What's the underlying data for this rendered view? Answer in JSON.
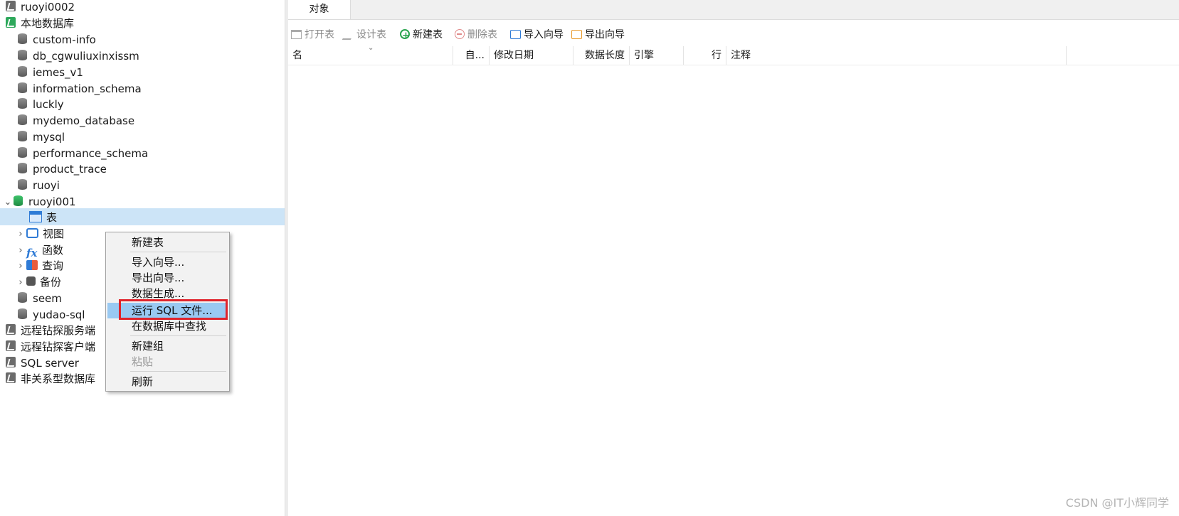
{
  "tree": {
    "connections_top": [
      {
        "label": "ruoyi0002"
      },
      {
        "label": "本地数据库"
      }
    ],
    "databases": [
      {
        "label": "custom-info"
      },
      {
        "label": "db_cgwuliuxinxissm"
      },
      {
        "label": "iemes_v1"
      },
      {
        "label": "information_schema"
      },
      {
        "label": "luckly"
      },
      {
        "label": "mydemo_database"
      },
      {
        "label": "mysql"
      },
      {
        "label": "performance_schema"
      },
      {
        "label": "product_trace"
      },
      {
        "label": "ruoyi"
      },
      {
        "label": "ruoyi001"
      }
    ],
    "ruoyi001_children": [
      {
        "label": "表",
        "icon": "table-icon"
      },
      {
        "label": "视图",
        "icon": "view-icon"
      },
      {
        "label": "函数",
        "icon": "function-icon"
      },
      {
        "label": "查询",
        "icon": "query-icon"
      },
      {
        "label": "备份",
        "icon": "backup-icon"
      }
    ],
    "databases_after": [
      {
        "label": "seem"
      },
      {
        "label": "yudao-sql"
      }
    ],
    "connections_bottom": [
      {
        "label": "远程钻探服务端"
      },
      {
        "label": "远程钻探客户端"
      },
      {
        "label": "SQL server"
      },
      {
        "label": "非关系型数据库"
      }
    ]
  },
  "context_menu": {
    "items": [
      {
        "label": "新建表"
      },
      {
        "label": "导入向导..."
      },
      {
        "label": "导出向导..."
      },
      {
        "label": "数据生成..."
      },
      {
        "label": "运行 SQL 文件...",
        "highlighted": true
      },
      {
        "label": "在数据库中查找"
      },
      {
        "label": "新建组"
      },
      {
        "label": "粘贴",
        "disabled": true
      },
      {
        "label": "刷新"
      }
    ]
  },
  "right": {
    "tab": "对象",
    "toolbar": {
      "open_table": "打开表",
      "design_table": "设计表",
      "new_table": "新建表",
      "delete_table": "删除表",
      "import_wizard": "导入向导",
      "export_wizard": "导出向导"
    },
    "columns": [
      "名",
      "自...",
      "修改日期",
      "数据长度",
      "引擎",
      "行",
      "注释"
    ]
  },
  "watermark": "CSDN @IT小辉同学",
  "colors": {
    "selection": "#cce4f7",
    "menu_highlight": "#99c9f2",
    "annotation_box": "#e0232b"
  }
}
